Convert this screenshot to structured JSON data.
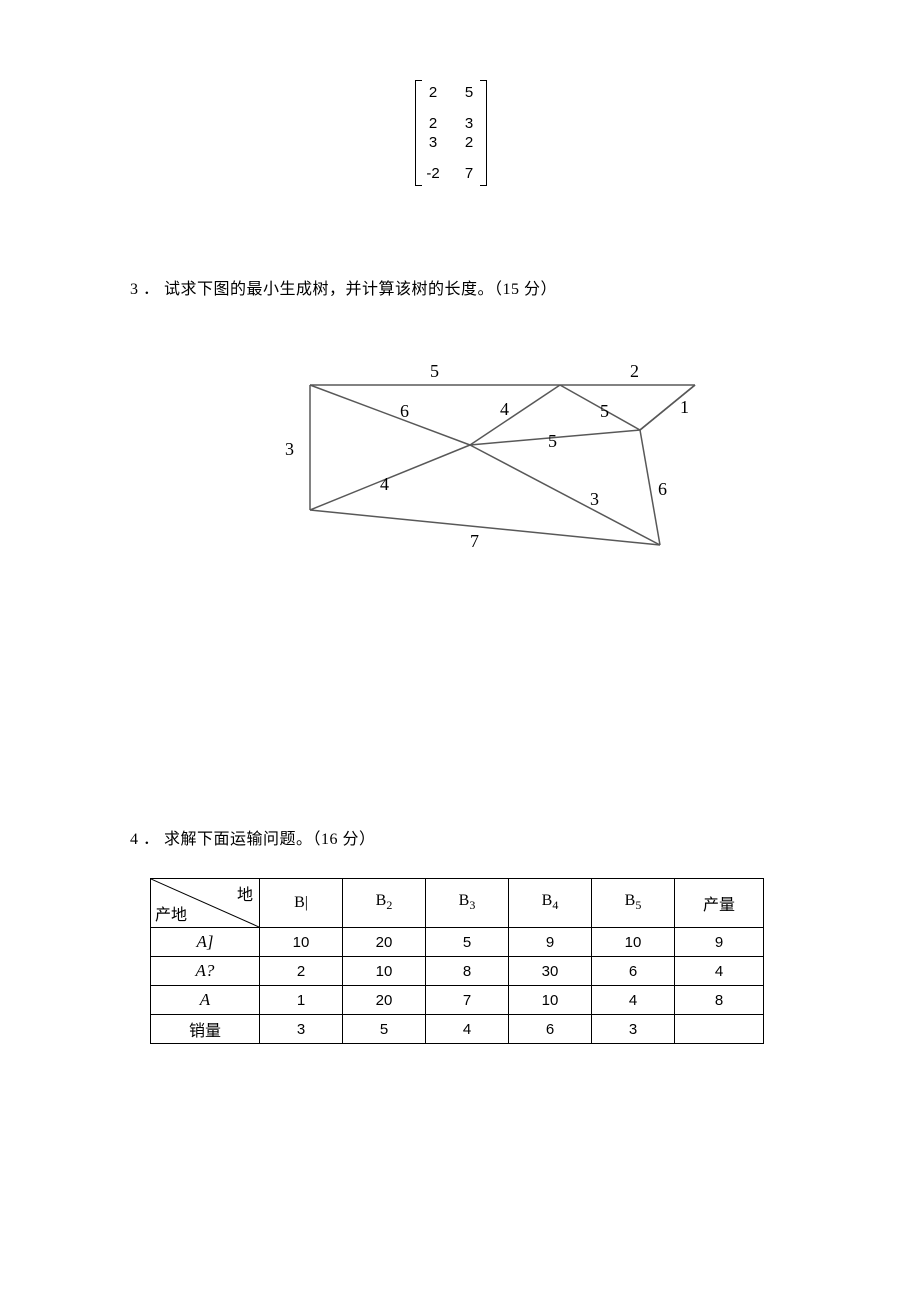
{
  "matrix": {
    "r1c1": "2",
    "r1c2": "5",
    "r2c1": "2",
    "r2c2": "3",
    "r3c1": "3",
    "r3c2": "2",
    "r4c1": "-2",
    "r4c2": "7"
  },
  "q3": {
    "num": "3",
    "sep": "．",
    "text": "试求下图的最小生成树，并计算该树的长度。（15 分）"
  },
  "graph": {
    "edges": {
      "top": "5",
      "top_right_left": "2",
      "right_far": "1",
      "inner_right": "5",
      "mid_horiz": "5",
      "upper_left_diag": "6",
      "upper_mid": "4",
      "left_side": "3",
      "lower_left_diag": "4",
      "lower_right_diag": "3",
      "right_side": "6",
      "bottom": "7"
    }
  },
  "q4": {
    "num": "4",
    "sep": "．",
    "text": "求解下面运输问题。（16 分）"
  },
  "table": {
    "corner_top": "地",
    "corner_bottom": "产地",
    "cols": {
      "b1": "B|",
      "b2": "B",
      "b2s": "2",
      "b3": "B",
      "b3s": "3",
      "b4": "B",
      "b4s": "4",
      "b5": "B",
      "b5s": "5",
      "supply": "产量"
    },
    "rows": {
      "a1": {
        "label": "A]",
        "c": [
          "10",
          "20",
          "5",
          "9",
          "10",
          "9"
        ]
      },
      "a2": {
        "label": "A?",
        "c": [
          "2",
          "10",
          "8",
          "30",
          "6",
          "4"
        ]
      },
      "a3": {
        "label": "A",
        "c": [
          "1",
          "20",
          "7",
          "10",
          "4",
          "8"
        ]
      },
      "demand": {
        "label": "销量",
        "c": [
          "3",
          "5",
          "4",
          "6",
          "3",
          ""
        ]
      }
    }
  }
}
